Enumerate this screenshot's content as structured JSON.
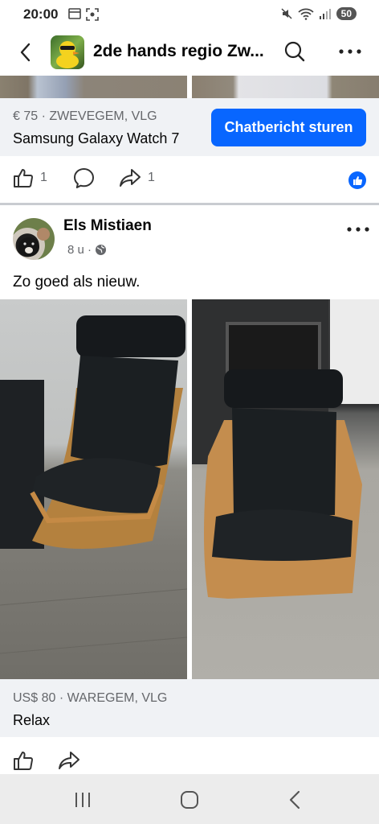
{
  "status_bar": {
    "time": "20:00",
    "battery": "50"
  },
  "header": {
    "group_title": "2de hands regio Zw..."
  },
  "listing1": {
    "meta": "€ 75 · ZWEVEGEM, VLG",
    "title": "Samsung Galaxy Watch 7",
    "chat_button": "Chatbericht sturen"
  },
  "actions1": {
    "like_count": "1",
    "share_count": "1"
  },
  "post": {
    "author": "Els Mistiaen",
    "time": "8 u ·",
    "text": "Zo goed als nieuw."
  },
  "listing2": {
    "meta": "US$ 80 · WAREGEM, VLG",
    "title": "Relax"
  },
  "colors": {
    "accent": "#0866ff",
    "muted_text": "#65676b",
    "listing_bg": "#f0f2f5"
  },
  "icons": [
    "back-icon",
    "search-icon",
    "more-icon",
    "like-icon",
    "comment-icon",
    "share-icon",
    "globe-icon",
    "nav-recents-icon",
    "nav-home-icon",
    "nav-back-icon"
  ]
}
